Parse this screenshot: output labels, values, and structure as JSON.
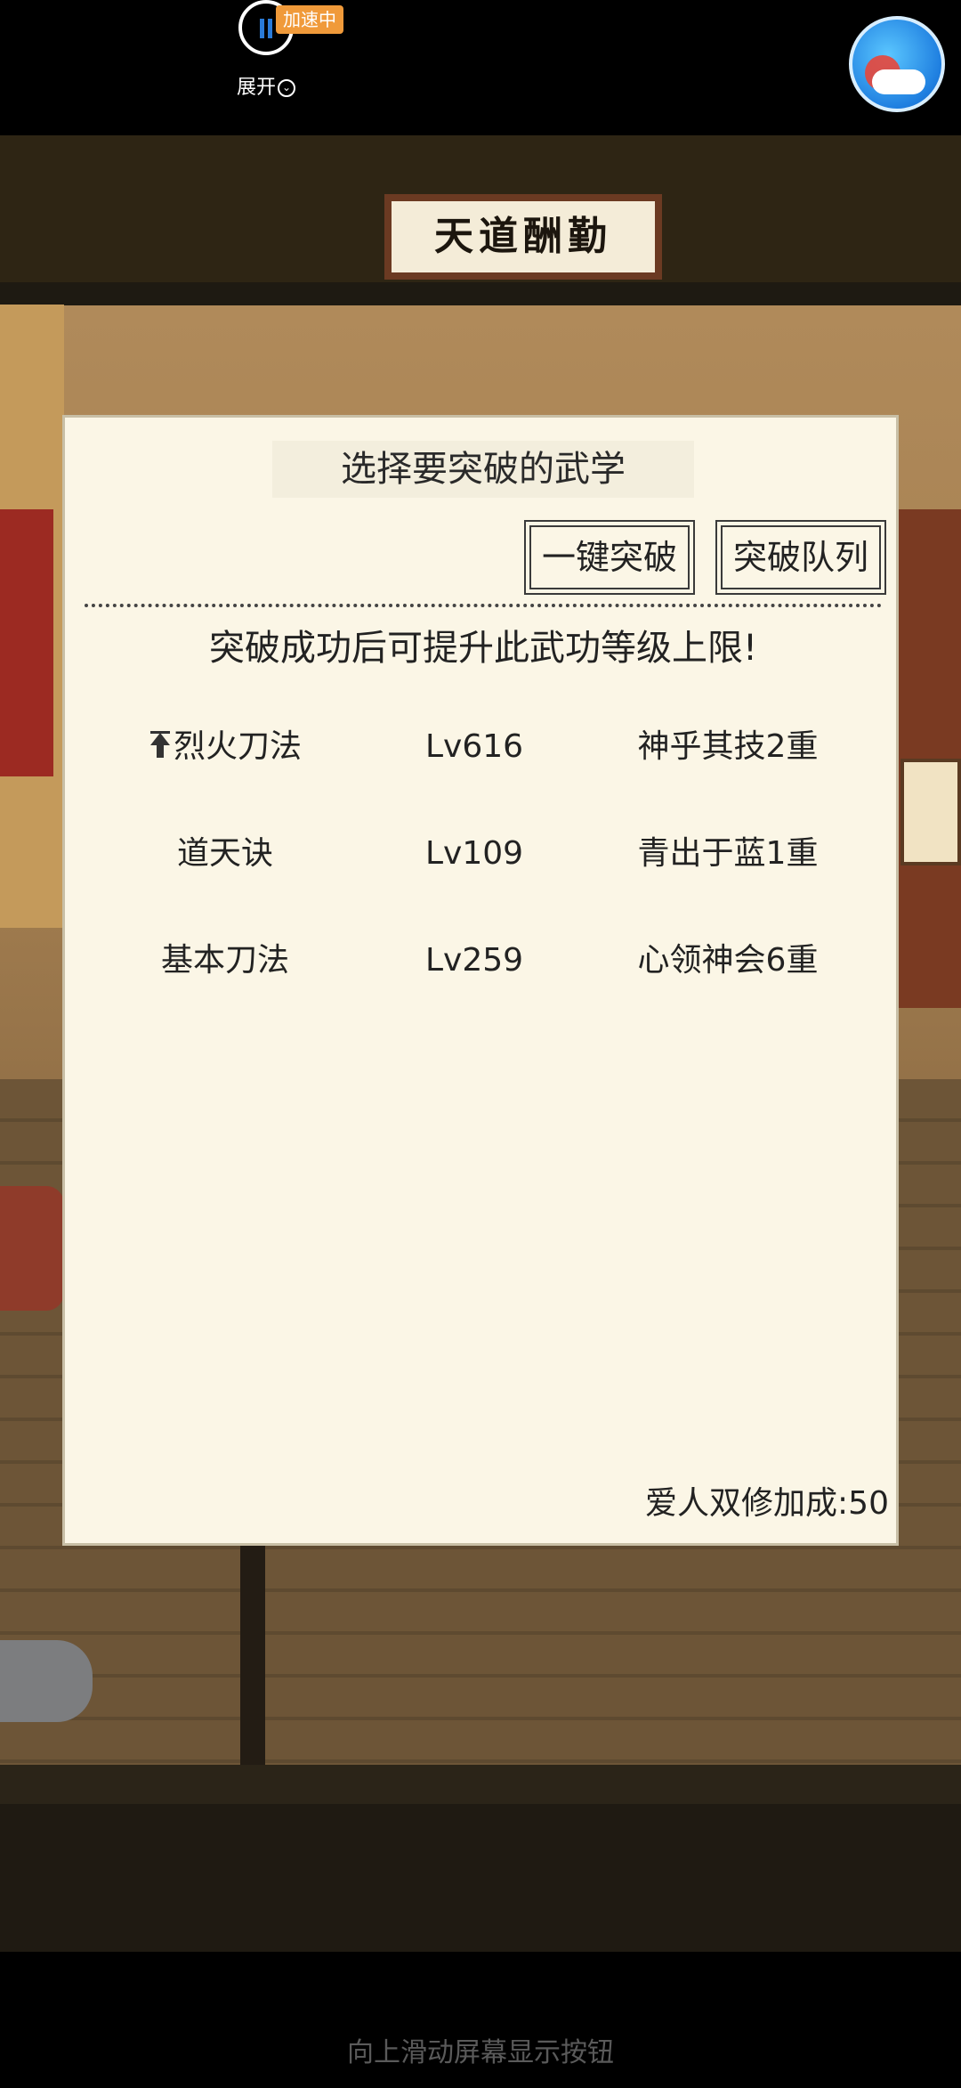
{
  "overlay": {
    "speed_badge": "加速中",
    "expand_label": "展开",
    "expand_icon": "chevron-down-circle-icon",
    "logo_icon": "gamepad-app-logo-icon"
  },
  "scene": {
    "plaque_text": "天道酬勤"
  },
  "dialog": {
    "title": "选择要突破的武学",
    "one_click_button": "一键突破",
    "queue_button": "突破队列",
    "hint": "突破成功后可提升此武功等级上限!",
    "skills": [
      {
        "name": "烈火刀法",
        "level": "Lv616",
        "stage": "神乎其技2重",
        "icon": "arrow-up-icon"
      },
      {
        "name": "道天诀",
        "level": "Lv109",
        "stage": "青出于蓝1重"
      },
      {
        "name": "基本刀法",
        "level": "Lv259",
        "stage": "心领神会6重"
      }
    ],
    "bonus": "爱人双修加成:50"
  },
  "system": {
    "bottom_hint": "向上滑动屏幕显示按钮"
  },
  "colors": {
    "dialog_bg": "#fbf6e6",
    "speed_badge": "#f09a3a",
    "text": "#222222"
  }
}
